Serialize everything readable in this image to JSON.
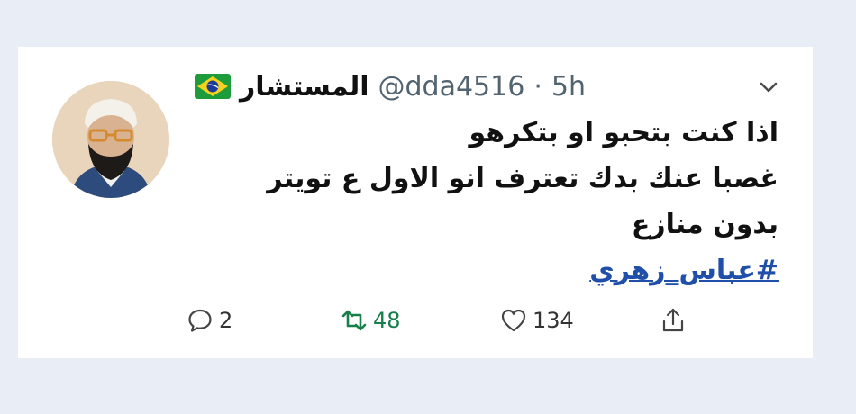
{
  "tweet": {
    "display_name": "المستشار",
    "handle": "@dda4516",
    "separator": "·",
    "time": "5h",
    "text_lines": [
      "اذا كنت بتحبو او بتكرهو",
      "غصبا عنك بدك تعترف انو الاول ع تويتر",
      "بدون منازع"
    ],
    "hashtag": "#عباس_زهري"
  },
  "actions": {
    "replies": "2",
    "retweets": "48",
    "likes": "134"
  },
  "colors": {
    "page_bg": "#e9edf5",
    "card_bg": "#ffffff",
    "hashtag": "#1f4fa8",
    "retweet_active": "#17804a",
    "meta": "#536471"
  },
  "icons": {
    "flag": "brazil-flag-icon",
    "menu": "chevron-down-icon",
    "reply": "reply-icon",
    "retweet": "retweet-icon",
    "like": "heart-icon",
    "share": "share-icon"
  }
}
